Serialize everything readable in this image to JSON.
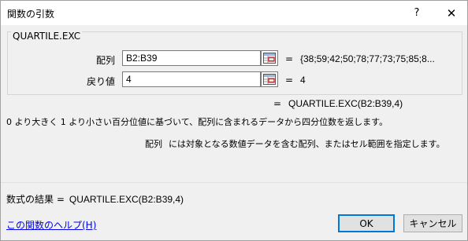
{
  "window": {
    "title": "関数の引数",
    "help_glyph": "?",
    "close_glyph": "✕"
  },
  "function": {
    "name": "QUARTILE.EXC"
  },
  "args": [
    {
      "label": "配列",
      "value": "B2:B39",
      "result": "{38;59;42;50;78;77;73;75;85;8..."
    },
    {
      "label": "戻り値",
      "value": "4",
      "result": "4"
    }
  ],
  "eq_sign": "=",
  "formula_result": "QUARTILE.EXC(B2:B39,4)",
  "description": "0 より大きく 1 より小さい百分位値に基づいて、配列に含まれるデータから四分位数を返します。",
  "arg_description": {
    "name": "配列",
    "text": "には対象となる数値データを含む配列、またはセル範囲を指定します。"
  },
  "calc_result": {
    "label": "数式の結果 =",
    "value": "QUARTILE.EXC(B2:B39,4)"
  },
  "help_link": "この関数のヘルプ(H)",
  "buttons": {
    "ok": "OK",
    "cancel": "キャンセル"
  },
  "icons": {
    "range_select": "range-select-icon"
  }
}
